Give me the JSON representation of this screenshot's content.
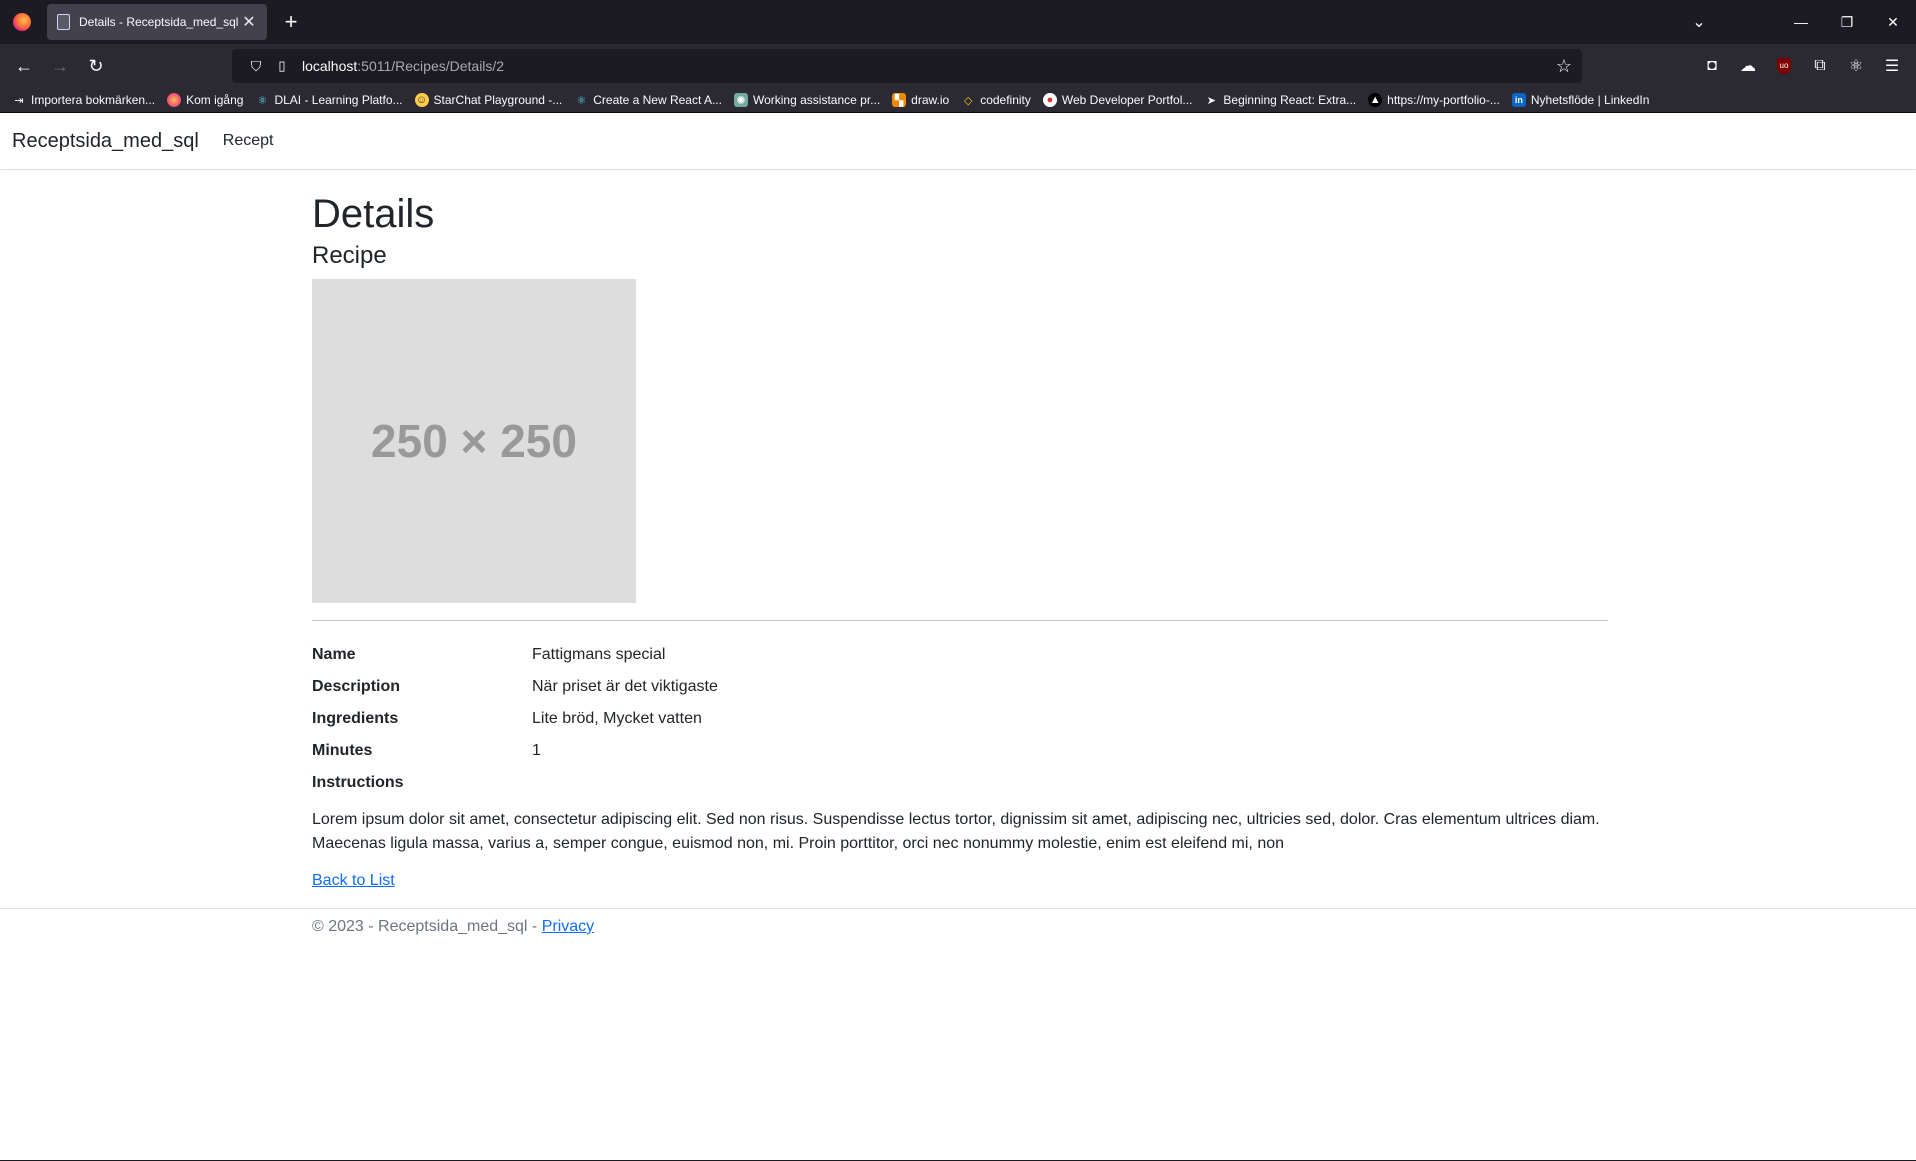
{
  "browser": {
    "tab_title": "Details - Receptsida_med_sql",
    "url_host": "localhost",
    "url_path": ":5011/Recipes/Details/2",
    "bookmarks": [
      {
        "label": "Importera bokmärken...",
        "icon": "import-icon"
      },
      {
        "label": "Kom igång",
        "icon": "firefox-icon"
      },
      {
        "label": "DLAI - Learning Platfo...",
        "icon": "react-icon"
      },
      {
        "label": "StarChat Playground -...",
        "icon": "huggingface-icon"
      },
      {
        "label": "Create a New React A...",
        "icon": "react-icon"
      },
      {
        "label": "Working assistance pr...",
        "icon": "openai-icon"
      },
      {
        "label": "draw.io",
        "icon": "drawio-icon"
      },
      {
        "label": "codefinity",
        "icon": "code-icon"
      },
      {
        "label": "Web Developer Portfol...",
        "icon": "portfolio-icon"
      },
      {
        "label": "Beginning React: Extra...",
        "icon": "send-icon"
      },
      {
        "label": "https://my-portfolio-...",
        "icon": "vercel-icon"
      },
      {
        "label": "Nyhetsflöde | LinkedIn",
        "icon": "linkedin-icon"
      }
    ]
  },
  "site": {
    "brand": "Receptsida_med_sql",
    "nav": [
      "Recept"
    ]
  },
  "page": {
    "title": "Details",
    "subtitle": "Recipe",
    "placeholder_image_text": "250 × 250",
    "fields": [
      {
        "label": "Name",
        "value": "Fattigmans special"
      },
      {
        "label": "Description",
        "value": "När priset är det viktigaste"
      },
      {
        "label": "Ingredients",
        "value": "Lite bröd, Mycket vatten"
      },
      {
        "label": "Minutes",
        "value": "1"
      },
      {
        "label": "Instructions",
        "value": ""
      }
    ],
    "instructions_text": "Lorem ipsum dolor sit amet, consectetur adipiscing elit. Sed non risus. Suspendisse lectus tortor, dignissim sit amet, adipiscing nec, ultricies sed, dolor. Cras elementum ultrices diam. Maecenas ligula massa, varius a, semper congue, euismod non, mi. Proin porttitor, orci nec nonummy molestie, enim est eleifend mi, non",
    "back_link": "Back to List"
  },
  "footer": {
    "text": "© 2023 - Receptsida_med_sql - ",
    "privacy_link": "Privacy"
  },
  "colors": {
    "link": "#0d6efd",
    "text": "#212529",
    "placeholder_bg": "#dddddd",
    "chrome_dark": "#1c1b22",
    "chrome_toolbar": "#2b2a33"
  }
}
